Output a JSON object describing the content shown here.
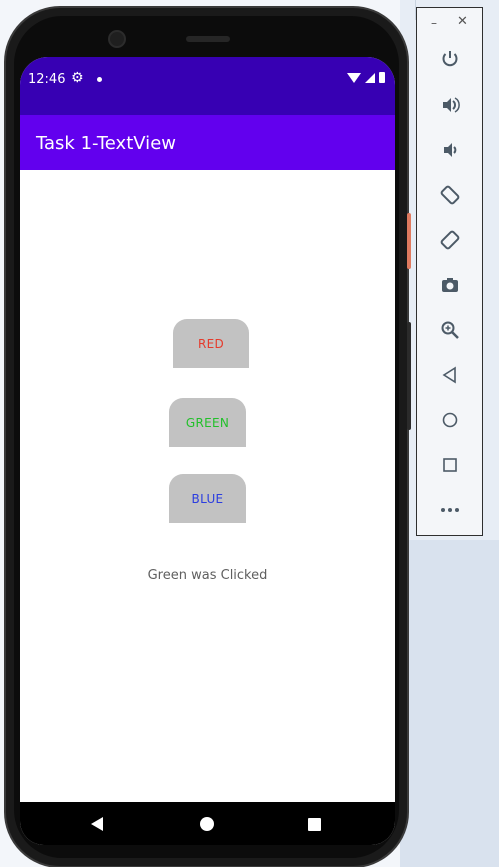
{
  "status_bar": {
    "time": "12:46",
    "settings_icon": "gear-icon",
    "color": "#3700b3"
  },
  "app_bar": {
    "title": "Task 1-TextView",
    "color": "#6200ee"
  },
  "buttons": {
    "red": {
      "label": "RED",
      "text_color": "#e53b2c"
    },
    "green": {
      "label": "GREEN",
      "text_color": "#22c02a"
    },
    "blue": {
      "label": "BLUE",
      "text_color": "#2b3de0"
    }
  },
  "result_text": "Green was Clicked",
  "emulator_toolbar": {
    "items": [
      {
        "name": "power-icon",
        "glyph": "⏻"
      },
      {
        "name": "volume-up-icon",
        "glyph": "🔊"
      },
      {
        "name": "volume-down-icon",
        "glyph": "🔉"
      },
      {
        "name": "rotate-left-icon",
        "glyph": "⟲"
      },
      {
        "name": "rotate-right-icon",
        "glyph": "⟳"
      },
      {
        "name": "camera-icon",
        "glyph": "📷"
      },
      {
        "name": "zoom-icon",
        "glyph": "🔍"
      },
      {
        "name": "back-icon",
        "glyph": "◁"
      },
      {
        "name": "home-icon",
        "glyph": "○"
      },
      {
        "name": "overview-icon",
        "glyph": "□"
      },
      {
        "name": "more-icon",
        "glyph": "•••"
      }
    ]
  }
}
